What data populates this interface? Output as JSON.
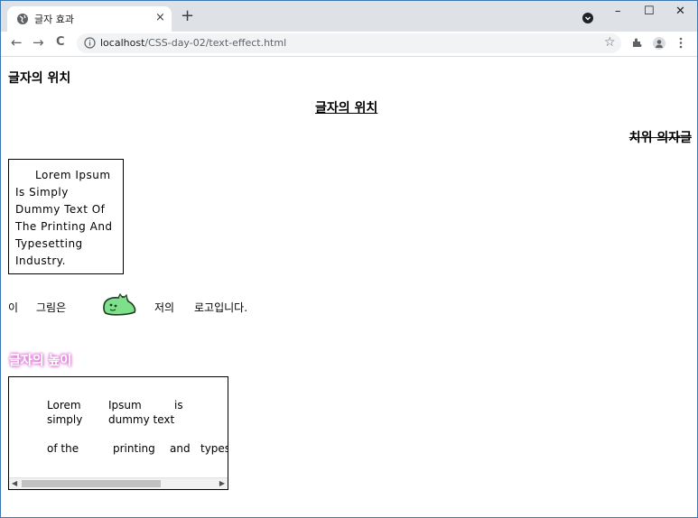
{
  "browser": {
    "tab_title": "글자 효과",
    "tab_close": "×",
    "new_tab": "+",
    "back": "←",
    "forward": "→",
    "reload": "C",
    "url_host": "localhost",
    "url_path": "/CSS-day-02/text-effect.html",
    "star": "☆",
    "win_min": "–",
    "win_max": "☐",
    "win_close": "✕"
  },
  "page": {
    "heading_left": "글자의 위치",
    "heading_center": "글자의 위치",
    "heading_right": "치위 의자글",
    "lorem_box": "Lorem Ipsum is simply dummy text of the printing and typesetting industry.",
    "logo_line": {
      "w1": "이",
      "w2": "그림은",
      "w3": "저의",
      "w4": "로고입니다."
    },
    "heading_height": "글자의 높이",
    "scroll_text": {
      "l1a": "Lorem",
      "l1b": "Ipsum",
      "l1c": "is",
      "l2a": "simply",
      "l2b": "dummy text",
      "l3a": "of the",
      "l3b": "printing",
      "l3c": "and",
      "l3d": "typeset"
    }
  },
  "colors": {
    "shadow": "#e36fd6",
    "dino": "#7ee08a"
  }
}
